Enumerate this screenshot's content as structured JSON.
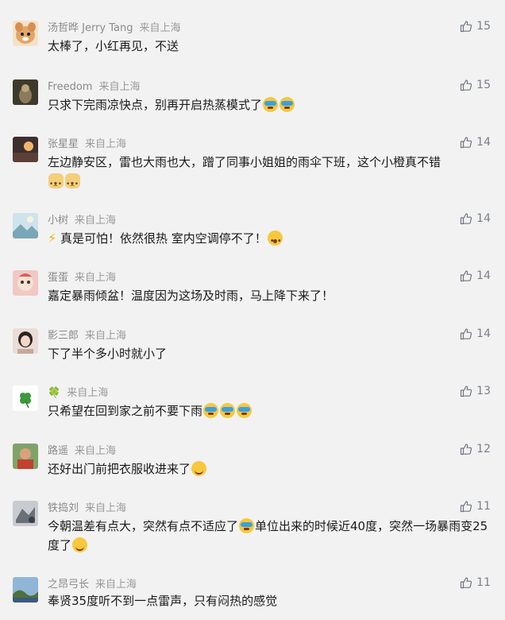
{
  "comments": [
    {
      "name": "汤哲晔 Jerry Tang",
      "from": "来自上海",
      "likes": "15",
      "text": "太棒了，小红再见，不送",
      "avatar_color": "#e9c9a8"
    },
    {
      "name": "Freedom",
      "from": "来自上海",
      "likes": "15",
      "text": "只求下完雨凉快点，别再开启热蒸模式了",
      "avatar_color": "#4a4636"
    },
    {
      "name": "张星星",
      "from": "来自上海",
      "likes": "14",
      "text": "左边静安区，雷也大雨也大，蹭了同事小姐姐的雨伞下班，这个小橙真不错",
      "avatar_color": "#5b4a45"
    },
    {
      "name": "小树",
      "from": "来自上海",
      "likes": "14",
      "text": "真是可怕！依然很热 室内空调停不了！",
      "avatar_color": "#b9d4dc"
    },
    {
      "name": "蛋蛋",
      "from": "来自上海",
      "likes": "14",
      "text": "嘉定暴雨倾盆！温度因为这场及时雨，马上降下来了！",
      "avatar_color": "#e7a7a2"
    },
    {
      "name": "影三郎",
      "from": "来自上海",
      "likes": "14",
      "text": "下了半个多小时就小了",
      "avatar_color": "#d9c2b8"
    },
    {
      "name": "🍀",
      "from": "来自上海",
      "likes": "13",
      "text": "只希望在回到家之前不要下雨",
      "avatar_color": "#ffffff"
    },
    {
      "name": "路遥",
      "from": "来自上海",
      "likes": "12",
      "text": "还好出门前把衣服收进来了",
      "avatar_color": "#6c8e5c"
    },
    {
      "name": "铁捣刘",
      "from": "来自上海",
      "likes": "11",
      "text_a": "今朝温差有点大，突然有点不适应了",
      "text_b": "单位出来的时候近40度，突然一场暴雨变25度了",
      "avatar_color": "#8e9399"
    },
    {
      "name": "之昂弓长",
      "from": "来自上海",
      "likes": "11",
      "text": "奉贤35度听不到一点雷声，只有闷热的感觉",
      "avatar_color": "#6a8fb3"
    }
  ]
}
